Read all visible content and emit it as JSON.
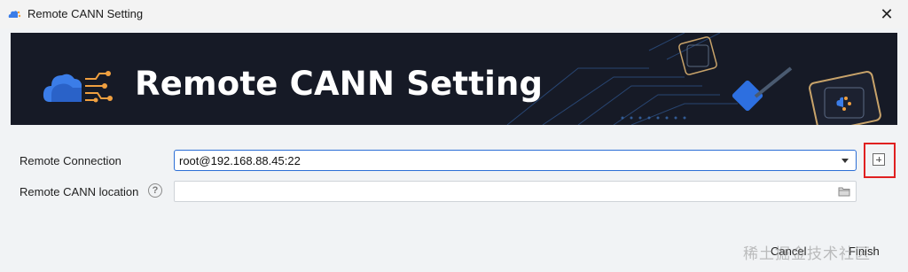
{
  "window": {
    "title": "Remote CANN Setting",
    "close_glyph": "✕"
  },
  "banner": {
    "title": "Remote CANN Setting"
  },
  "form": {
    "connection_label": "Remote Connection",
    "connection_value": "root@192.168.88.45:22",
    "location_label": "Remote CANN location",
    "location_value": "",
    "help_glyph": "?"
  },
  "footer": {
    "cancel_label": "Cancel",
    "finish_label": "Finish",
    "watermark": "稀土掘金技术社区"
  },
  "icons": {
    "app": "cann-cloud-icon",
    "add": "add-connection-icon",
    "folder": "folder-icon",
    "help": "help-icon"
  },
  "colors": {
    "banner_bg": "#161a26",
    "accent_blue": "#2c6fd6",
    "highlight_red": "#e02020",
    "orange": "#f0a040"
  }
}
